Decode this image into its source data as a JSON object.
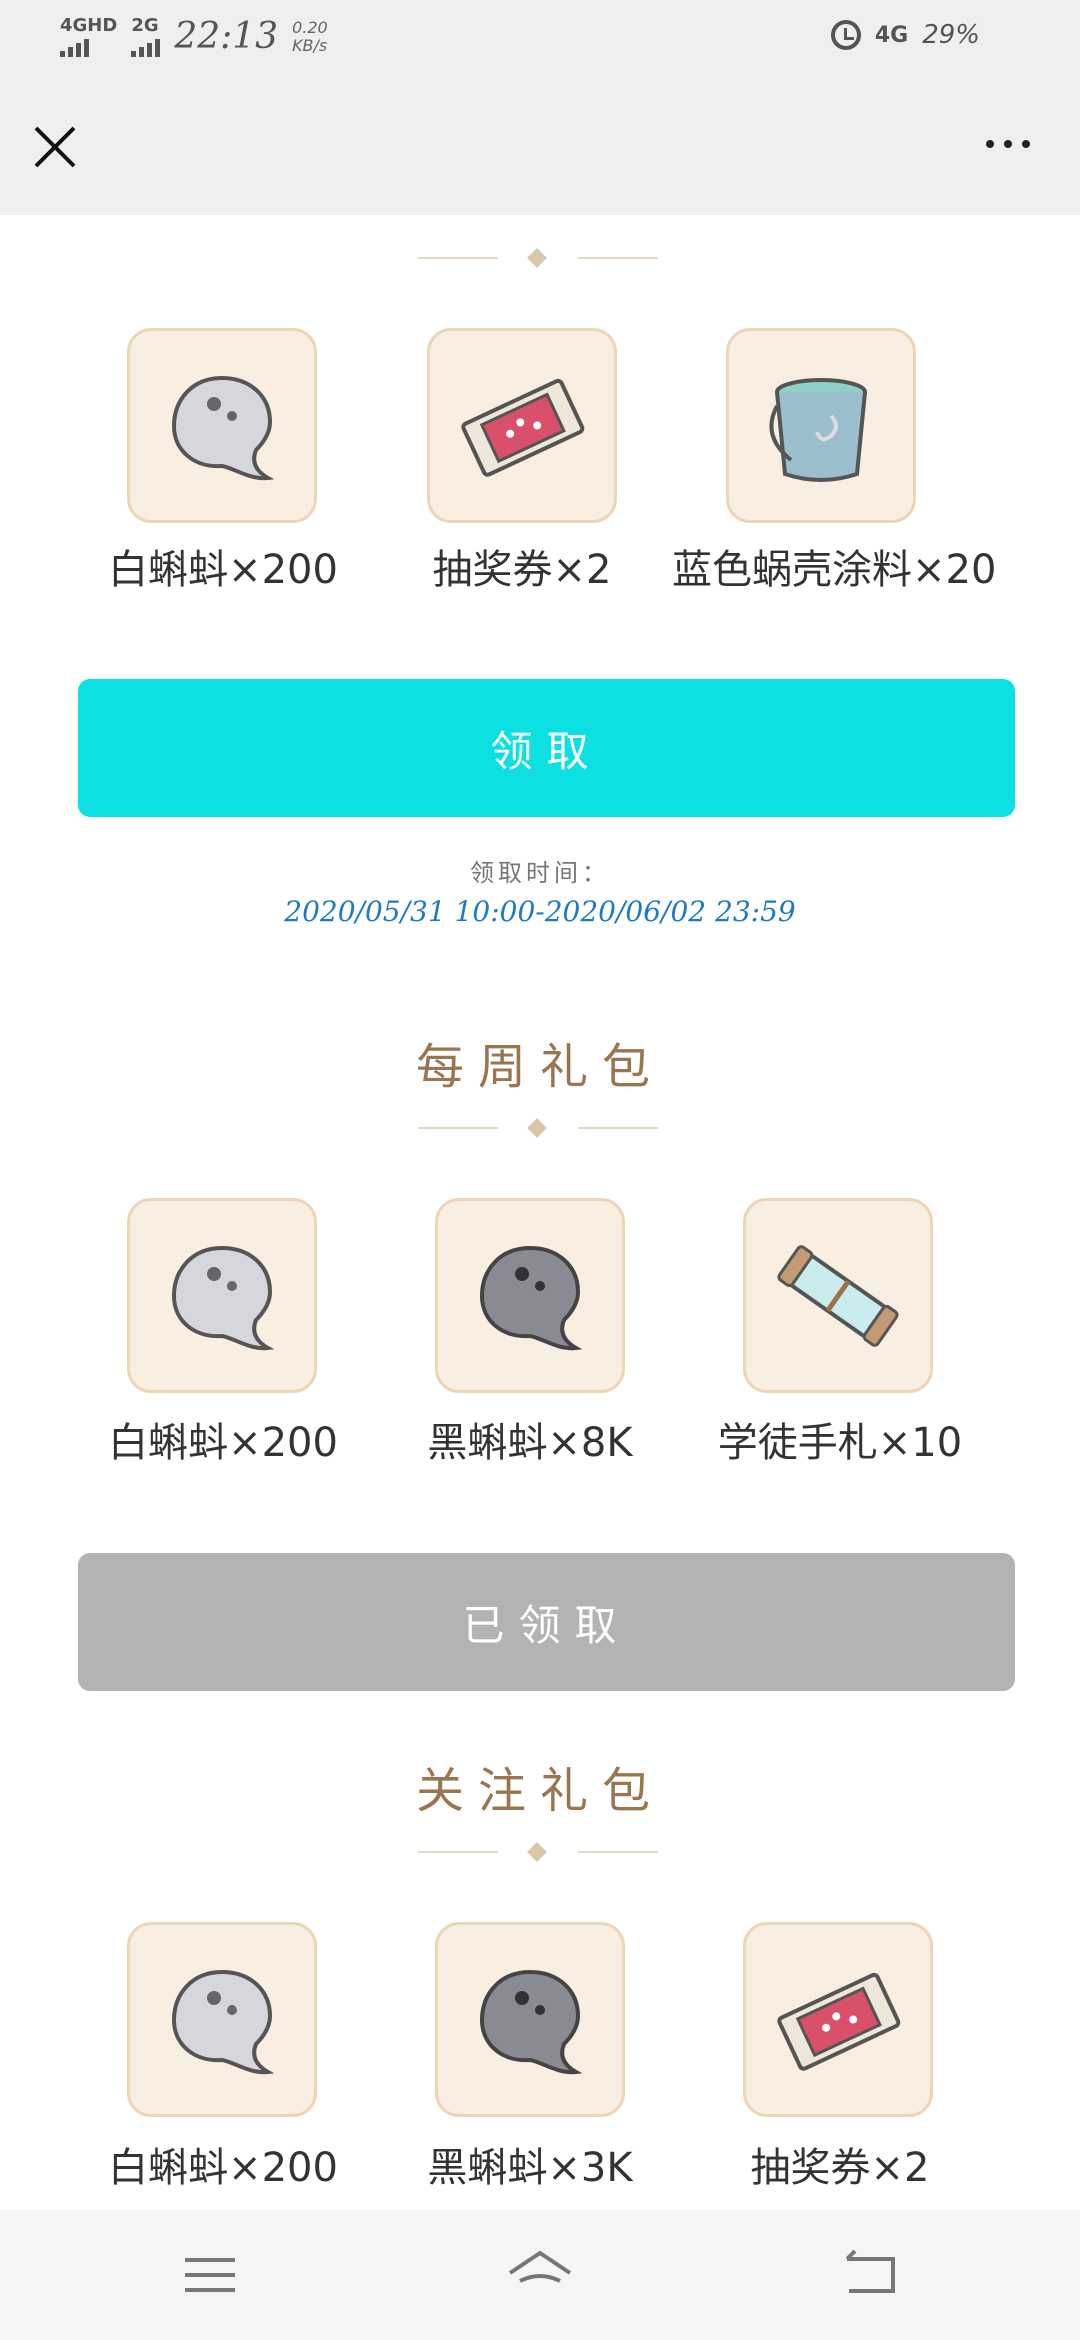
{
  "status_bar": {
    "network1": "4GHD",
    "network2": "2G",
    "time": "22:13",
    "speed_value": "0.20",
    "speed_unit": "KB/s",
    "network_right": "4G",
    "battery": "29%"
  },
  "nav": {
    "close_icon": "close-icon",
    "more_icon": "more-icon"
  },
  "sections": [
    {
      "items": [
        {
          "label": "白蝌蚪×200",
          "icon": "white-tadpole"
        },
        {
          "label": "抽奖券×2",
          "icon": "lottery-ticket"
        },
        {
          "label": "蓝色蜗壳涂料×20",
          "icon": "paint-bucket"
        }
      ],
      "button_label": "领取",
      "button_state": "active",
      "time_label": "领取时间：",
      "time_range": "2020/05/31 10:00-2020/06/02 23:59"
    },
    {
      "title": "每周礼包",
      "items": [
        {
          "label": "白蝌蚪×200",
          "icon": "white-tadpole"
        },
        {
          "label": "黑蝌蚪×8K",
          "icon": "black-tadpole"
        },
        {
          "label": "学徒手札×10",
          "icon": "scroll"
        }
      ],
      "button_label": "已领取",
      "button_state": "done"
    },
    {
      "title": "关注礼包",
      "items": [
        {
          "label": "白蝌蚪×200",
          "icon": "white-tadpole"
        },
        {
          "label": "黑蝌蚪×3K",
          "icon": "black-tadpole"
        },
        {
          "label": "抽奖券×2",
          "icon": "lottery-ticket"
        }
      ]
    }
  ],
  "bottom_nav": {
    "menu_icon": "menu-icon",
    "home_icon": "home-icon",
    "back_icon": "back-icon"
  },
  "colors": {
    "claim_button": "#0ce0e3",
    "claimed_button": "#b3b3b3",
    "section_title": "#9a7650",
    "time_range": "#1f79c7",
    "tile_bg": "#f8eee1"
  }
}
